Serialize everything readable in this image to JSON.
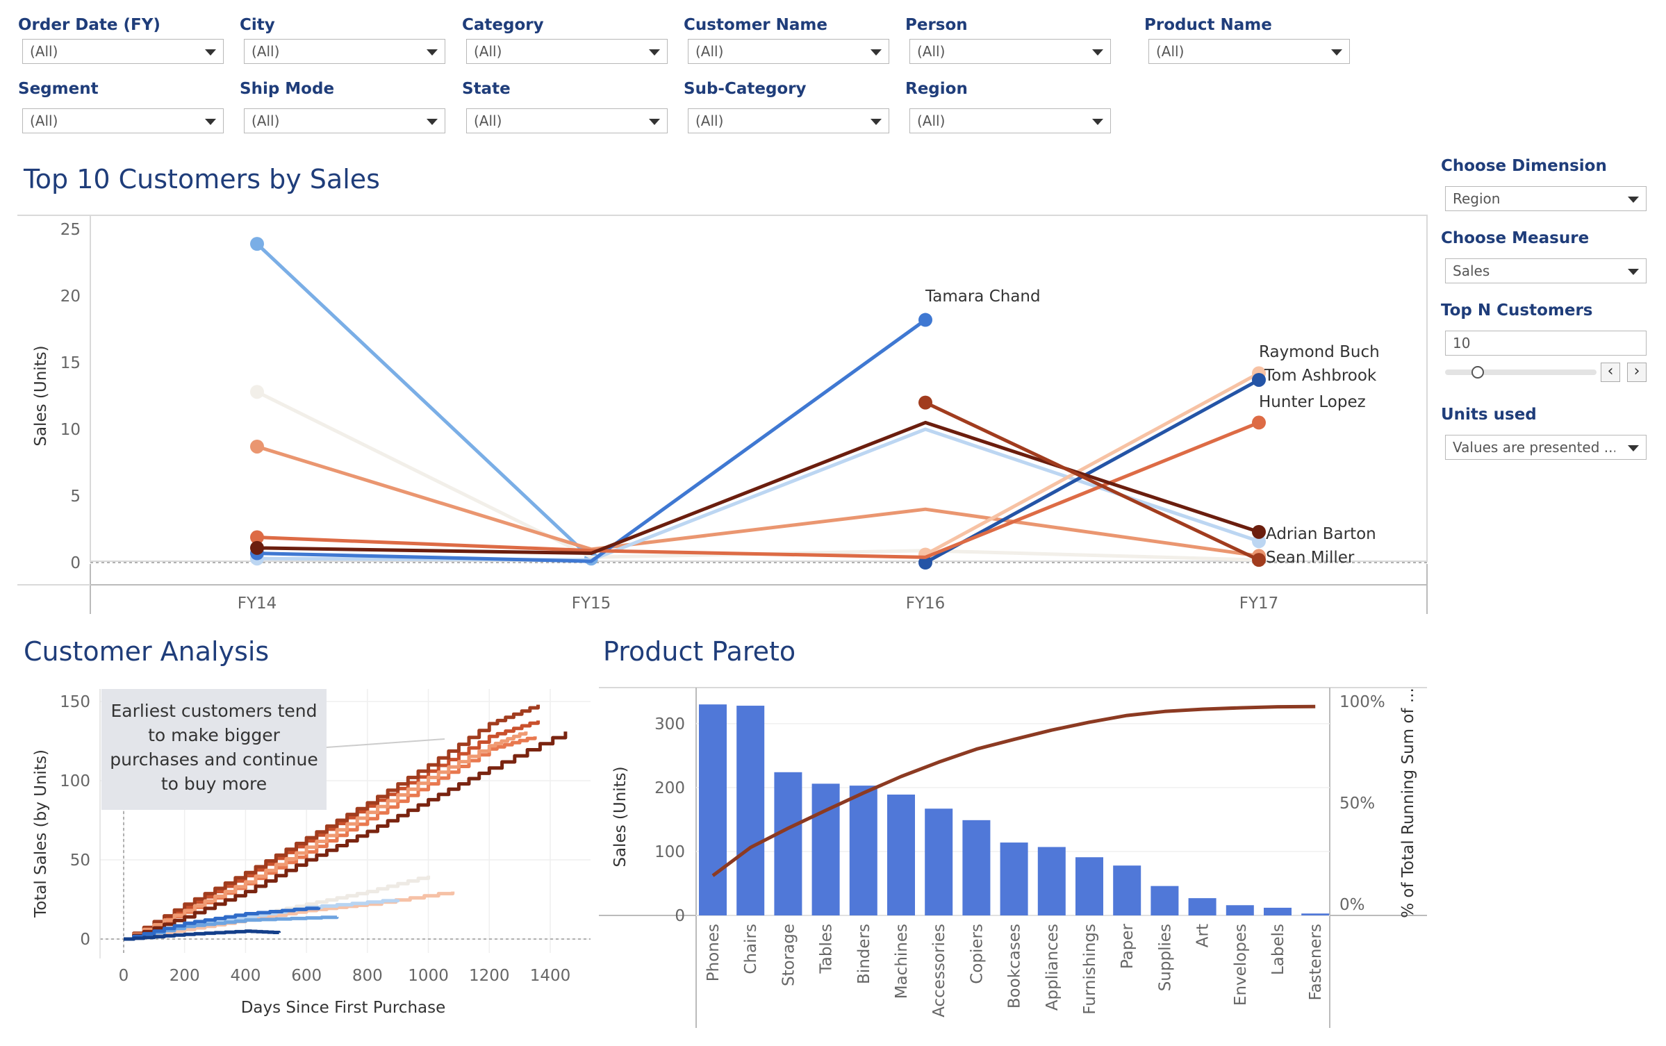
{
  "filters": {
    "row1": [
      {
        "label": "Order Date (FY)",
        "value": "(All)"
      },
      {
        "label": "City",
        "value": "(All)"
      },
      {
        "label": "Category",
        "value": "(All)"
      },
      {
        "label": "Customer Name",
        "value": "(All)"
      },
      {
        "label": "Person",
        "value": "(All)"
      },
      {
        "label": "Product Name",
        "value": "(All)"
      }
    ],
    "row2": [
      {
        "label": "Segment",
        "value": "(All)"
      },
      {
        "label": "Ship Mode",
        "value": "(All)"
      },
      {
        "label": "State",
        "value": "(All)"
      },
      {
        "label": "Sub-Category",
        "value": "(All)"
      },
      {
        "label": "Region",
        "value": "(All)"
      }
    ]
  },
  "parameters": {
    "dimension": {
      "label": "Choose Dimension",
      "value": "Region"
    },
    "measure": {
      "label": "Choose Measure",
      "value": "Sales"
    },
    "topn": {
      "label": "Top N Customers",
      "value": "10",
      "slider_fraction": 0.1
    },
    "units": {
      "label": "Units used",
      "value": "Values are presented ..."
    }
  },
  "icons": {
    "dropdown": "chevron-down-icon",
    "prev": "chevron-left-icon",
    "next": "chevron-right-icon"
  },
  "chart_data": [
    {
      "type": "line",
      "title": "Top 10 Customers by Sales",
      "ylabel": "Sales (Units)",
      "xlabel": "",
      "categories": [
        "FY14",
        "FY15",
        "FY16",
        "FY17"
      ],
      "ylim": [
        0,
        25
      ],
      "yticks": [
        0,
        5,
        10,
        15,
        20,
        25
      ],
      "series": [
        {
          "name": "",
          "color": "#7aaee6",
          "values": [
            23.9,
            0.3,
            null,
            null
          ]
        },
        {
          "name": "",
          "color": "#f2efe9",
          "values": [
            12.8,
            0.4,
            0.9,
            0.2
          ]
        },
        {
          "name": "",
          "color": "#ea9670",
          "values": [
            8.7,
            1.0,
            4.0,
            0.5
          ]
        },
        {
          "name": "",
          "color": "#bcd6f2",
          "values": [
            0.3,
            0.2,
            10.0,
            1.6
          ]
        },
        {
          "name": "Tamara Chand",
          "color": "#3f78d2",
          "values": [
            0.7,
            0.1,
            18.2,
            null
          ]
        },
        {
          "name": "Raymond Buch",
          "color": "#f7c2a4",
          "values": [
            null,
            null,
            0.6,
            14.2
          ]
        },
        {
          "name": "Tom Ashbrook",
          "color": "#2454a6",
          "values": [
            null,
            null,
            0.0,
            13.7
          ]
        },
        {
          "name": "Hunter Lopez",
          "color": "#dd6b45",
          "values": [
            1.9,
            0.9,
            0.4,
            10.5
          ]
        },
        {
          "name": "Adrian Barton",
          "color": "#6b1e0e",
          "values": [
            1.1,
            0.7,
            10.5,
            2.3
          ]
        },
        {
          "name": "Sean Miller",
          "color": "#a13c1e",
          "values": [
            null,
            null,
            12.0,
            0.2
          ]
        }
      ]
    },
    {
      "type": "line",
      "title": "Customer Analysis",
      "xlabel": "Days Since First Purchase",
      "ylabel": "Total Sales (by Units)",
      "xlim": [
        -80,
        1520
      ],
      "ylim": [
        -12,
        155
      ],
      "xticks": [
        0,
        200,
        400,
        600,
        800,
        1000,
        1200,
        1400
      ],
      "yticks": [
        0,
        50,
        100,
        150
      ],
      "annotation": "Earliest customers tend to make bigger purchases and continue to buy more",
      "series": [
        {
          "color": "#e8784f",
          "x": [
            0,
            200,
            400,
            600,
            800,
            1000,
            1200,
            1350
          ],
          "y": [
            0,
            17,
            35,
            55,
            76,
            98,
            120,
            128
          ]
        },
        {
          "color": "#c9502c",
          "x": [
            0,
            200,
            400,
            600,
            800,
            1000,
            1200,
            1360
          ],
          "y": [
            0,
            20,
            40,
            62,
            84,
            106,
            128,
            138
          ]
        },
        {
          "color": "#a13c1e",
          "x": [
            0,
            200,
            400,
            600,
            800,
            1000,
            1200,
            1360
          ],
          "y": [
            0,
            22,
            42,
            64,
            86,
            110,
            136,
            148
          ]
        },
        {
          "color": "#f09a72",
          "x": [
            0,
            200,
            400,
            600,
            800,
            1000,
            1200,
            1320
          ],
          "y": [
            0,
            18,
            36,
            58,
            80,
            102,
            122,
            131
          ]
        },
        {
          "color": "#7a2410",
          "x": [
            0,
            200,
            400,
            600,
            800,
            1000,
            1200,
            1450
          ],
          "y": [
            0,
            14,
            30,
            50,
            68,
            88,
            108,
            131
          ]
        },
        {
          "color": "#eeeae4",
          "x": [
            0,
            200,
            400,
            600,
            800,
            1000
          ],
          "y": [
            0,
            7,
            14,
            22,
            30,
            40
          ]
        },
        {
          "color": "#f6c1a6",
          "x": [
            0,
            200,
            400,
            600,
            800,
            1080
          ],
          "y": [
            0,
            6,
            12,
            18,
            22,
            30
          ]
        },
        {
          "color": "#b8d4f2",
          "x": [
            0,
            200,
            400,
            600,
            900
          ],
          "y": [
            0,
            8,
            14,
            20,
            25
          ]
        },
        {
          "color": "#6ea4e0",
          "x": [
            0,
            200,
            400,
            700
          ],
          "y": [
            0,
            8,
            12,
            14
          ]
        },
        {
          "color": "#2f6bc8",
          "x": [
            0,
            200,
            400,
            640
          ],
          "y": [
            0,
            10,
            16,
            20
          ]
        },
        {
          "color": "#143f8a",
          "x": [
            0,
            200,
            400,
            510
          ],
          "y": [
            0,
            3,
            5,
            4
          ]
        }
      ]
    },
    {
      "type": "bar",
      "title": "Product Pareto",
      "ylabel": "Sales (Units)",
      "y2label": "% of Total Running Sum of ...",
      "categories": [
        "Phones",
        "Chairs",
        "Storage",
        "Tables",
        "Binders",
        "Machines",
        "Accessories",
        "Copiers",
        "Bookcases",
        "Appliances",
        "Furnishings",
        "Paper",
        "Supplies",
        "Art",
        "Envelopes",
        "Labels",
        "Fasteners"
      ],
      "values": [
        330,
        328,
        224,
        206,
        203,
        189,
        167,
        149,
        114,
        107,
        91,
        78,
        46,
        27,
        16,
        12,
        3
      ],
      "ylim": [
        0,
        340
      ],
      "yticks": [
        0,
        100,
        200,
        300
      ],
      "y2ticks": [
        "0%",
        "50%",
        "100%"
      ],
      "running_pct": [
        14.1,
        28.0,
        37.5,
        46.3,
        54.9,
        63.0,
        70.1,
        76.5,
        81.3,
        85.9,
        89.8,
        93.1,
        95.1,
        96.2,
        96.9,
        97.4,
        97.5
      ],
      "bar_color": "#5078d8",
      "line_color": "#8c3a22"
    }
  ]
}
